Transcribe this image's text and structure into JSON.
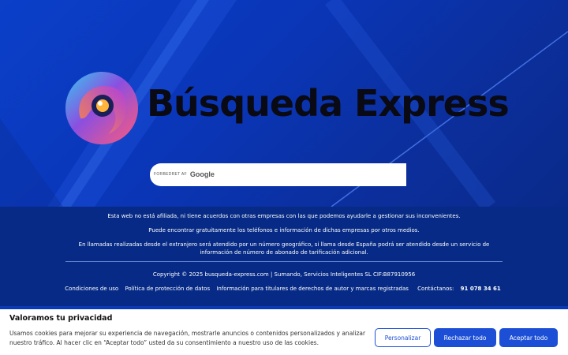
{
  "brand": {
    "name": "Búsqueda Express"
  },
  "search": {
    "placeholder": "",
    "branding_prefix": "FORBEDRET AF",
    "branding_name": "Google"
  },
  "footer": {
    "line1": "Esta web no está afiliada, ni tiene acuerdos con otras empresas con las que podemos ayudarle a gestionar sus inconvenientes.",
    "line2": "Puede encontrar gratuitamente los teléfonos e información de dichas empresas por otros medios.",
    "line3": "En llamadas realizadas desde el extranjero será atendido por un número geográfico, si llama desde España podrá ser atendido desde un servicio de información de número de abonado de tarificación adicional.",
    "copyright": "Copyright © 2025 busqueda-express.com | Sumando, Servicios Inteligentes SL CIF:B87910956",
    "links": {
      "terms": "Condiciones de uso",
      "privacy": "Política de protección de datos",
      "rights": "Información para titulares de derechos de autor y marcas registradas",
      "contact_label": "Contáctanos:",
      "contact_phone": "91 078 34 61"
    }
  },
  "cookie": {
    "title": "Valoramos tu privacidad",
    "text": "Usamos cookies para mejorar su experiencia de navegación, mostrarle anuncios o contenidos personalizados y analizar nuestro tráfico. Al hacer clic en “Aceptar todo” usted da su consentimiento a nuestro uso de las cookies.",
    "customize_label": "Personalizar",
    "reject_label": "Rechazar todo",
    "accept_label": "Aceptar todo"
  },
  "colors": {
    "hero_bg": "#0b3fc9",
    "footer_bg": "#062a85",
    "button_accent": "#1c4fd6"
  }
}
